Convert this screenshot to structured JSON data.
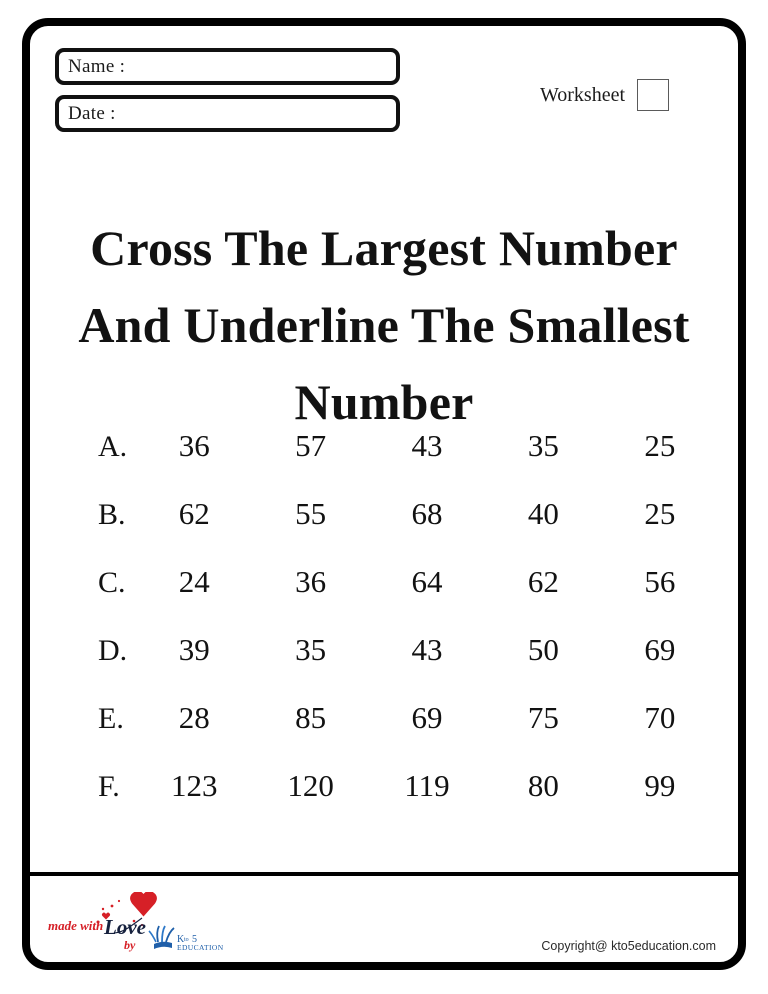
{
  "header": {
    "name_field_label": "Name :",
    "date_field_label": "Date :",
    "name_field_value": "",
    "date_field_value": "",
    "worksheet_label": "Worksheet",
    "worksheet_number": ""
  },
  "title": "Cross The Largest Number And Underline The Smallest Number",
  "grid": {
    "rows": [
      {
        "label": "A.",
        "values": [
          "36",
          "57",
          "43",
          "35",
          "25"
        ]
      },
      {
        "label": "B.",
        "values": [
          "62",
          "55",
          "68",
          "40",
          "25"
        ]
      },
      {
        "label": "C.",
        "values": [
          "24",
          "36",
          "64",
          "62",
          "56"
        ]
      },
      {
        "label": "D.",
        "values": [
          "39",
          "35",
          "43",
          "50",
          "69"
        ]
      },
      {
        "label": "E.",
        "values": [
          "28",
          "85",
          "69",
          "75",
          "70"
        ]
      },
      {
        "label": "F.",
        "values": [
          "123",
          "120",
          "119",
          "80",
          "99"
        ]
      }
    ]
  },
  "footer": {
    "logo_made_with": "made with",
    "logo_love": "Love",
    "logo_by": "by",
    "logo_brand_k": "K",
    "logo_brand_to": "to",
    "logo_brand_5": "5",
    "logo_brand_education": "EDUCATION",
    "copyright": "Copyright@ kto5education.com"
  },
  "colors": {
    "ink": "#121212",
    "frame": "#000000",
    "heart_red": "#D62027",
    "script_navy": "#16213E",
    "brand_blue": "#1F5FA9",
    "paper": "#FFFFFF"
  }
}
